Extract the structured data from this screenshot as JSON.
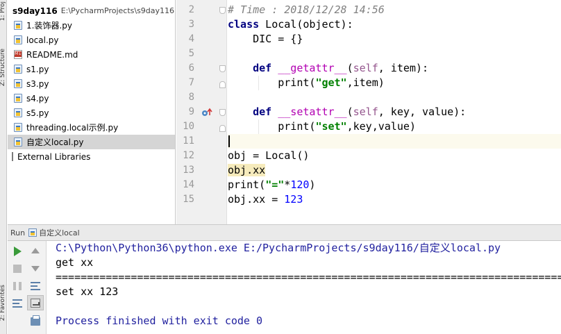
{
  "left_strip": {
    "top_label": "1: Proj",
    "structure_label": "Z: Structure",
    "favorites_label": "2: Favorites"
  },
  "project": {
    "root_name": "s9day116",
    "root_path": "E:\\PycharmProjects\\s9day116",
    "files": [
      {
        "name": "1.装饰器.py",
        "icon": "python-file-icon"
      },
      {
        "name": "local.py",
        "icon": "python-file-icon"
      },
      {
        "name": "README.md",
        "icon": "markdown-file-icon"
      },
      {
        "name": "s1.py",
        "icon": "python-file-icon"
      },
      {
        "name": "s3.py",
        "icon": "python-file-icon"
      },
      {
        "name": "s4.py",
        "icon": "python-file-icon"
      },
      {
        "name": "s5.py",
        "icon": "python-file-icon"
      },
      {
        "name": "threading.local示例.py",
        "icon": "python-file-icon"
      },
      {
        "name": "自定义local.py",
        "icon": "python-file-icon",
        "selected": true
      }
    ],
    "external_libraries": "External Libraries"
  },
  "editor": {
    "line_numbers": [
      "2",
      "3",
      "4",
      "5",
      "6",
      "7",
      "8",
      "9",
      "10",
      "11",
      "12",
      "13",
      "14",
      "15"
    ],
    "current_line": "11"
  },
  "run_panel": {
    "label": "Run",
    "config_name": "自定义local"
  },
  "console": {
    "command": "C:\\Python\\Python36\\python.exe E:/PycharmProjects/s9day116/自定义local.py",
    "line1": "get xx",
    "separator": "========================================================================================================================",
    "line2": "set xx 123",
    "line3": "",
    "exit": "Process finished with exit code 0"
  }
}
